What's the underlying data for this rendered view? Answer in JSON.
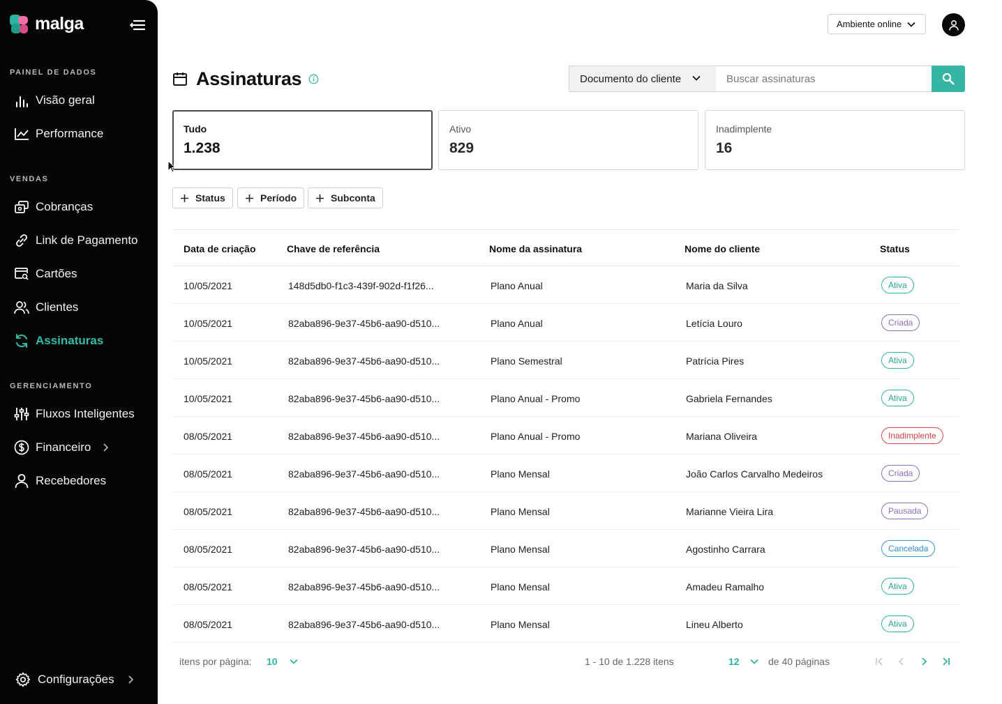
{
  "brand": {
    "name": "malga"
  },
  "sidebar": {
    "sections": [
      {
        "title": "PAINEL DE DADOS",
        "items": [
          {
            "label": "Visão geral",
            "icon": "bar-chart-icon"
          },
          {
            "label": "Performance",
            "icon": "line-chart-icon"
          }
        ]
      },
      {
        "title": "VENDAS",
        "items": [
          {
            "label": "Cobranças",
            "icon": "charges-icon"
          },
          {
            "label": "Link de Pagamento",
            "icon": "link-icon"
          },
          {
            "label": "Cartões",
            "icon": "card-search-icon"
          },
          {
            "label": "Clientes",
            "icon": "users-icon"
          },
          {
            "label": "Assinaturas",
            "icon": "refresh-icon",
            "active": true
          }
        ]
      },
      {
        "title": "GERENCIAMENTO",
        "items": [
          {
            "label": "Fluxos Inteligentes",
            "icon": "sliders-icon"
          },
          {
            "label": "Financeiro",
            "icon": "dollar-circle-icon"
          },
          {
            "label": "Recebedores",
            "icon": "user-icon"
          }
        ]
      }
    ],
    "settings_label": "Configurações"
  },
  "topbar": {
    "environment": "Ambiente online"
  },
  "page": {
    "title": "Assinaturas",
    "search_filter": "Documento do cliente",
    "search_placeholder": "Buscar assinaturas"
  },
  "cards": [
    {
      "label": "Tudo",
      "value": "1.238",
      "selected": true
    },
    {
      "label": "Ativo",
      "value": "829"
    },
    {
      "label": "Inadimplente",
      "value": "16"
    }
  ],
  "filters": [
    "Status",
    "Período",
    "Subconta"
  ],
  "table": {
    "columns": [
      "Data de criação",
      "Chave de referência",
      "Nome da assinatura",
      "Nome do cliente",
      "Status"
    ],
    "rows": [
      [
        "10/05/2021",
        "148d5db0-f1c3-439f-902d-f1f26...",
        "Plano Anual",
        "Maria da Silva",
        "Ativa"
      ],
      [
        "10/05/2021",
        "82aba896-9e37-45b6-aa90-d510...",
        "Plano Anual",
        "Letícia Louro",
        "Criada"
      ],
      [
        "10/05/2021",
        "82aba896-9e37-45b6-aa90-d510...",
        "Plano Semestral",
        "Patrícia Pires",
        "Ativa"
      ],
      [
        "10/05/2021",
        "82aba896-9e37-45b6-aa90-d510...",
        "Plano Anual - Promo",
        "Gabriela Fernandes",
        "Ativa"
      ],
      [
        "08/05/2021",
        "82aba896-9e37-45b6-aa90-d510...",
        "Plano Anual - Promo",
        "Mariana Oliveira",
        "Inadimplente"
      ],
      [
        "08/05/2021",
        "82aba896-9e37-45b6-aa90-d510...",
        "Plano Mensal",
        "João Carlos Carvalho Medeiros",
        "Criada"
      ],
      [
        "08/05/2021",
        "82aba896-9e37-45b6-aa90-d510...",
        "Plano Mensal",
        "Marianne Vieira Lira",
        "Pausada"
      ],
      [
        "08/05/2021",
        "82aba896-9e37-45b6-aa90-d510...",
        "Plano Mensal",
        "Agostinho Carrara",
        "Cancelada"
      ],
      [
        "08/05/2021",
        "82aba896-9e37-45b6-aa90-d510...",
        "Plano Mensal",
        "Amadeu Ramalho",
        "Ativa"
      ],
      [
        "08/05/2021",
        "82aba896-9e37-45b6-aa90-d510...",
        "Plano Mensal",
        "Lineu Alberto",
        "Ativa"
      ]
    ]
  },
  "pagination": {
    "per_page_label": "itens por página:",
    "per_page": "10",
    "range": "1 - 10 de 1.228 itens",
    "current_page": "12",
    "total_pages": "de 40 páginas"
  },
  "colors": {
    "accent": "#35b5a3",
    "sidebar": "#050505"
  }
}
